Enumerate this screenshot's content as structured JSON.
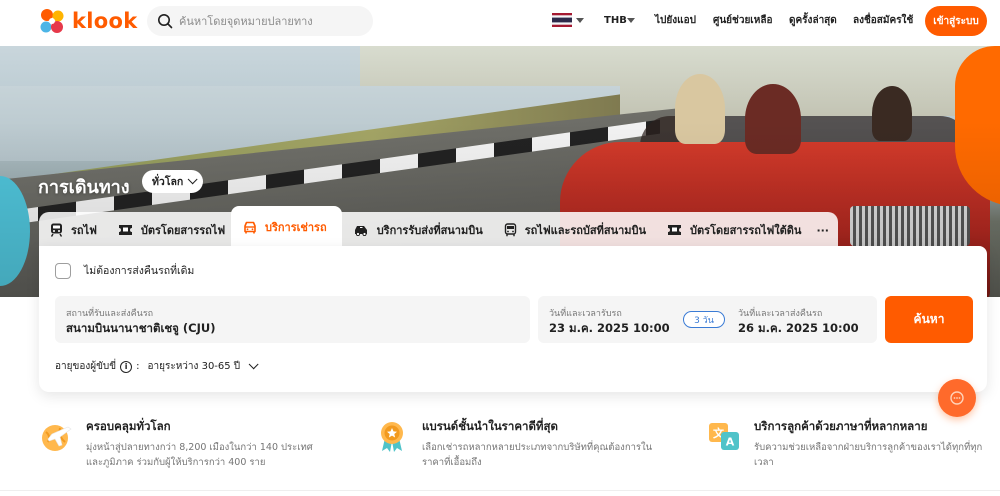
{
  "brand": {
    "name": "klook",
    "accent": "#ff5b00"
  },
  "header": {
    "search_placeholder": "ค้นหาโดยจุดหมายปลายทาง",
    "currency": "THB",
    "nav": [
      "ไปยังแอป",
      "ศูนย์ช่วยเหลือ",
      "ดูครั้งล่าสุด",
      "ลงชื่อสมัครใช้"
    ],
    "login_label": "เข้าสู่ระบบ",
    "flag_icon": "thailand-flag-icon"
  },
  "hero": {
    "title": "การเดินทาง",
    "region_label": "ทั่วโลก"
  },
  "tabs": [
    {
      "label": "รถไฟ",
      "icon": "train-icon"
    },
    {
      "label": "บัตรโดยสารรถไฟ",
      "icon": "rail-pass-icon"
    },
    {
      "label": "บริการเช่ารถ",
      "icon": "car-rental-icon",
      "active": true
    },
    {
      "label": "บริการรับส่งที่สนามบิน",
      "icon": "airport-transfer-icon"
    },
    {
      "label": "รถไฟและรถบัสที่สนามบิน",
      "icon": "airport-bus-icon"
    },
    {
      "label": "บัตรโดยสารรถไฟใต้ดิน",
      "icon": "metro-pass-icon"
    },
    {
      "label": "···",
      "icon": "more-icon"
    }
  ],
  "booking": {
    "return_checkbox_label": "ไม่ต้องการส่งคืนรถที่เดิม",
    "return_checked": false,
    "location_label": "สถานที่รับและส่งคืนรถ",
    "location_value": "สนามบินนานาชาติเชจู (CJU)",
    "pickup_label": "วันที่และเวลารับรถ",
    "pickup_value": "23 ม.ค. 2025 10:00",
    "days_label": "3 วัน",
    "dropoff_label": "วันที่และเวลาส่งคืนรถ",
    "dropoff_value": "26 ม.ค. 2025 10:00",
    "search_label": "ค้นหา",
    "age_label": "อายุของผู้ขับขี่",
    "age_colon": ":",
    "age_value": "อายุระหว่าง 30-65 ปี"
  },
  "features": [
    {
      "icon": "globe-plane-icon",
      "title": "ครอบคลุมทั่วโลก",
      "desc_line1": "มุ่งหน้าสู่ปลายทางกว่า 8,200 เมืองในกว่า 140 ประเทศ",
      "desc_line2": "และภูมิภาค ร่วมกับผู้ให้บริการกว่า 400 ราย"
    },
    {
      "icon": "medal-icon",
      "title": "แบรนด์ชั้นนำในราคาดีที่สุด",
      "desc_line1": "เลือกเช่ารถหลากหลายประเภทจากบริษัทที่คุณต้องการใน",
      "desc_line2": "ราคาที่เอื้อมถึง"
    },
    {
      "icon": "translate-icon",
      "title": "บริการลูกค้าด้วยภาษาที่หลากหลาย",
      "desc_line1": "รับความช่วยเหลือจากฝ่ายบริการลูกค้าของเราได้ทุกที่ทุก",
      "desc_line2": "เวลา"
    }
  ]
}
